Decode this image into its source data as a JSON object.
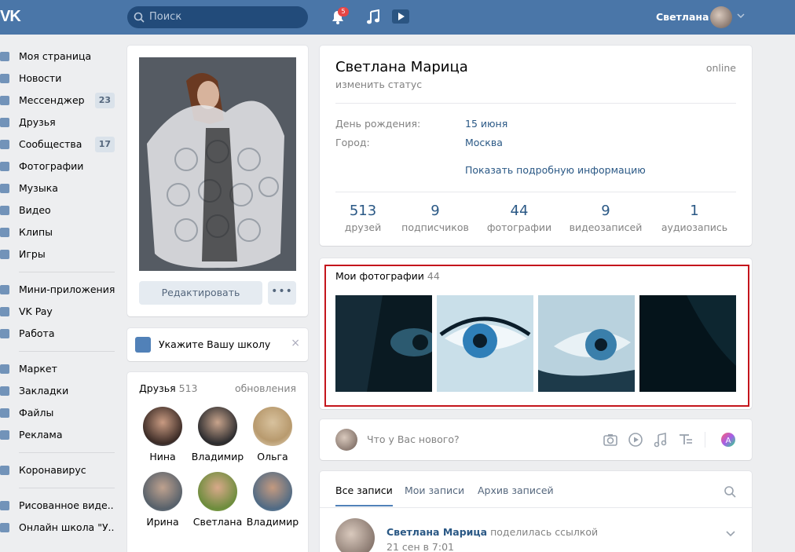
{
  "topbar": {
    "logo": "VK",
    "search_placeholder": "Поиск",
    "notifications_count": "5",
    "user_name": "Светлана"
  },
  "sidebar": {
    "items": [
      {
        "label": "Моя страница"
      },
      {
        "label": "Новости"
      },
      {
        "label": "Мессенджер",
        "count": "23"
      },
      {
        "label": "Друзья"
      },
      {
        "label": "Сообщества",
        "count": "17"
      },
      {
        "label": "Фотографии"
      },
      {
        "label": "Музыка"
      },
      {
        "label": "Видео"
      },
      {
        "label": "Клипы"
      },
      {
        "label": "Игры"
      },
      {
        "label": "Мини-приложения"
      },
      {
        "label": "VK Pay"
      },
      {
        "label": "Работа"
      },
      {
        "label": "Маркет"
      },
      {
        "label": "Закладки"
      },
      {
        "label": "Файлы"
      },
      {
        "label": "Реклама"
      },
      {
        "label": "Коронавирус"
      },
      {
        "label": "Рисованное виде.."
      },
      {
        "label": "Онлайн школа \"У.."
      }
    ]
  },
  "profile": {
    "edit_label": "Редактировать",
    "more_label": "•••",
    "school_prompt": "Укажите Вашу школу",
    "school_close": "×",
    "name": "Светлана Марица",
    "status": "изменить статус",
    "online": "online",
    "birthday_label": "День рождения:",
    "birthday_value": "15 июня",
    "city_label": "Город:",
    "city_value": "Москва",
    "show_more": "Показать подробную информацию",
    "counters": [
      {
        "value": "513",
        "label": "друзей"
      },
      {
        "value": "9",
        "label": "подписчиков"
      },
      {
        "value": "44",
        "label": "фотографии"
      },
      {
        "value": "9",
        "label": "видеозаписей"
      },
      {
        "value": "1",
        "label": "аудиозапись"
      }
    ]
  },
  "friends": {
    "title": "Друзья",
    "count": "513",
    "updates": "обновления",
    "list": [
      {
        "name": "Нина"
      },
      {
        "name": "Владимир"
      },
      {
        "name": "Ольга"
      },
      {
        "name": "Ирина"
      },
      {
        "name": "Светлана"
      },
      {
        "name": "Владимир"
      }
    ]
  },
  "photos": {
    "title": "Мои фотографии",
    "count": "44"
  },
  "composer": {
    "placeholder": "Что у Вас нового?"
  },
  "wall": {
    "tabs": [
      "Все записи",
      "Мои записи",
      "Архив записей"
    ],
    "post_author": "Светлана Марица",
    "post_action": "поделилась ссылкой",
    "post_date": "21 сен в 7:01"
  },
  "colors": {
    "header": "#4a76a8",
    "link": "#2a5885",
    "highlight_frame": "#c4151c"
  }
}
